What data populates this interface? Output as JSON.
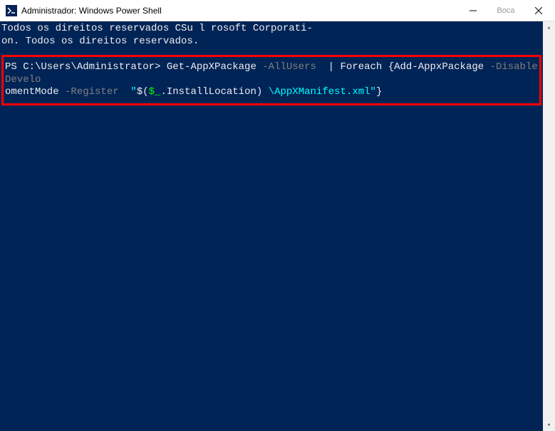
{
  "titlebar": {
    "title": "Administrador: Windows Power Shell",
    "maximize_label": "Boca"
  },
  "terminal": {
    "header1": "Todos os direitos reservados CSu l rosoft Corporati-",
    "header2": "on. Todos os direitos reservados.",
    "prompt": "PS C:\\Users\\Administrator> ",
    "cmd1a": "Get-AppXPackage ",
    "param1": "-AllUsers ",
    "pipe": " | ",
    "cmd1b": "Foreach ",
    "brace_open": "{",
    "cmd1c": "Add-AppxPackage ",
    "param2": "-DisableDevelo",
    "line2a": "omentMode ",
    "param3": "-Register ",
    "quote1": " \"",
    "dollar1": "$(",
    "var": "$_",
    "method": ".InstallLocation) ",
    "path": "\\AppXManifest.xml",
    "quote2": "\"",
    "brace_close": "}"
  },
  "scroll": {
    "up": "▴",
    "down": "▾"
  }
}
